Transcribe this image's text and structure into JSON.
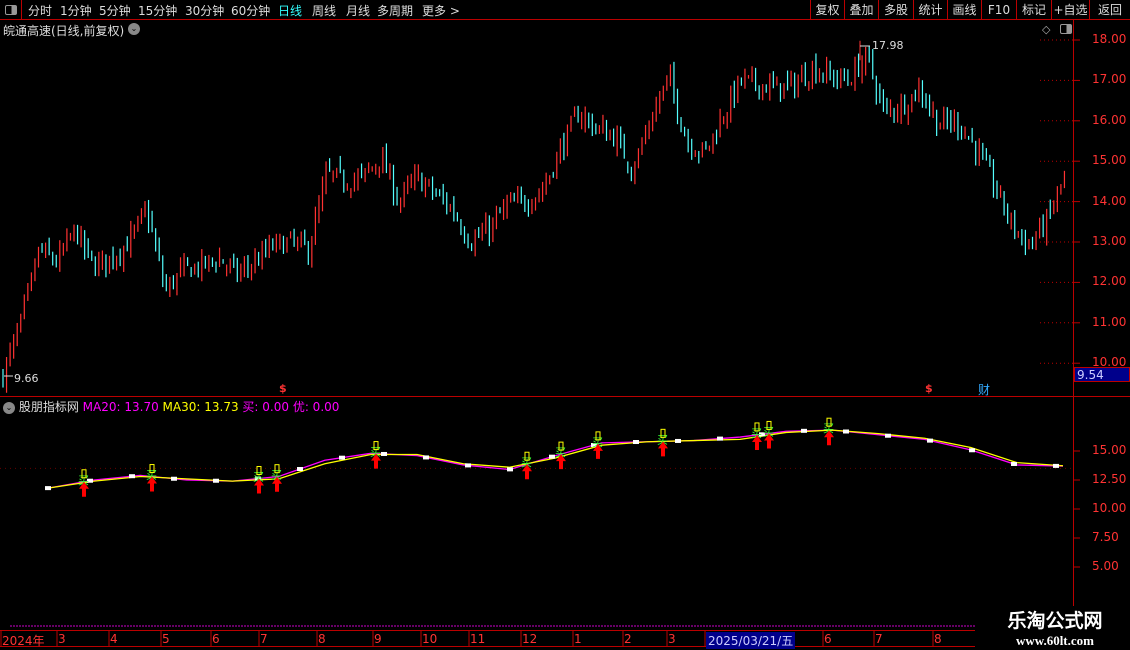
{
  "toolbar": {
    "tabs": [
      "分时",
      "1分钟",
      "5分钟",
      "15分钟",
      "30分钟",
      "60分钟",
      "日线",
      "周线",
      "月线",
      "多周期",
      "更多 >"
    ],
    "active": "日线",
    "right_buttons": [
      "复权",
      "叠加",
      "多股",
      "统计",
      "画线",
      "F10",
      "标记",
      "+自选",
      "返回"
    ]
  },
  "main_chart": {
    "title": "皖通高速(日线,前复权)",
    "high_label": "17.98",
    "low_label": "9.66",
    "current_price": "9.54",
    "y_ticks": [
      "18.00",
      "17.00",
      "16.00",
      "15.00",
      "14.00",
      "13.00",
      "12.00",
      "11.00",
      "10.00"
    ],
    "markers": [
      "$",
      "$",
      "财"
    ],
    "up_color": "#ff3232",
    "down_color": "#54ffff",
    "closes": [
      9.7,
      11.0,
      12.8,
      12.5,
      13.3,
      12.4,
      12.6,
      13.0,
      13.8,
      11.8,
      12.3,
      12.4,
      12.6,
      12.2,
      12.5,
      12.9,
      13.0,
      12.8,
      14.7,
      14.5,
      14.6,
      15.1,
      14.0,
      14.6,
      14.2,
      13.8,
      13.0,
      13.3,
      13.9,
      14.0,
      14.3,
      15.3,
      16.2,
      15.8,
      15.6,
      14.8,
      16.0,
      17.1,
      15.5,
      15.2,
      16.1,
      17.0,
      16.9,
      16.8,
      16.9,
      17.3,
      17.1,
      17.0,
      17.6,
      16.2,
      16.4,
      16.8,
      15.9,
      16.0,
      15.4,
      14.5,
      13.5,
      12.9,
      13.5,
      14.6
    ]
  },
  "indicator": {
    "name": "股朋指标网",
    "ma20_label": "MA20: 13.70",
    "ma30_label": "MA30: 13.73",
    "buy_label": "买: 0.00",
    "you_label": "优: 0.00",
    "y_ticks": [
      "15.00",
      "12.50",
      "10.00",
      "7.50",
      "5.00"
    ],
    "buy_glyph": "买",
    "ma20_color": "#ff00ff",
    "ma30_color": "#ffff00",
    "ma20": [
      11.8,
      12.5,
      12.9,
      12.5,
      12.4,
      12.8,
      14.2,
      14.8,
      14.6,
      13.8,
      13.4,
      14.6,
      15.7,
      15.8,
      15.9,
      16.2,
      16.7,
      16.8,
      16.4,
      16.0,
      15.1,
      13.8,
      13.7
    ],
    "ma30": [
      11.8,
      12.4,
      12.8,
      12.6,
      12.4,
      12.6,
      13.9,
      14.7,
      14.7,
      13.9,
      13.6,
      14.4,
      15.5,
      15.8,
      15.9,
      16.0,
      16.6,
      16.8,
      16.5,
      16.1,
      15.3,
      14.0,
      13.73
    ]
  },
  "time_axis": {
    "labels": [
      "2024年",
      "3",
      "4",
      "5",
      "6",
      "7",
      "8",
      "9",
      "10",
      "11",
      "12",
      "1",
      "2",
      "3",
      "2025/03/21/五",
      "6",
      "7",
      "8"
    ]
  },
  "watermark": {
    "name": "乐淘公式网",
    "url": "www.60lt.com"
  }
}
